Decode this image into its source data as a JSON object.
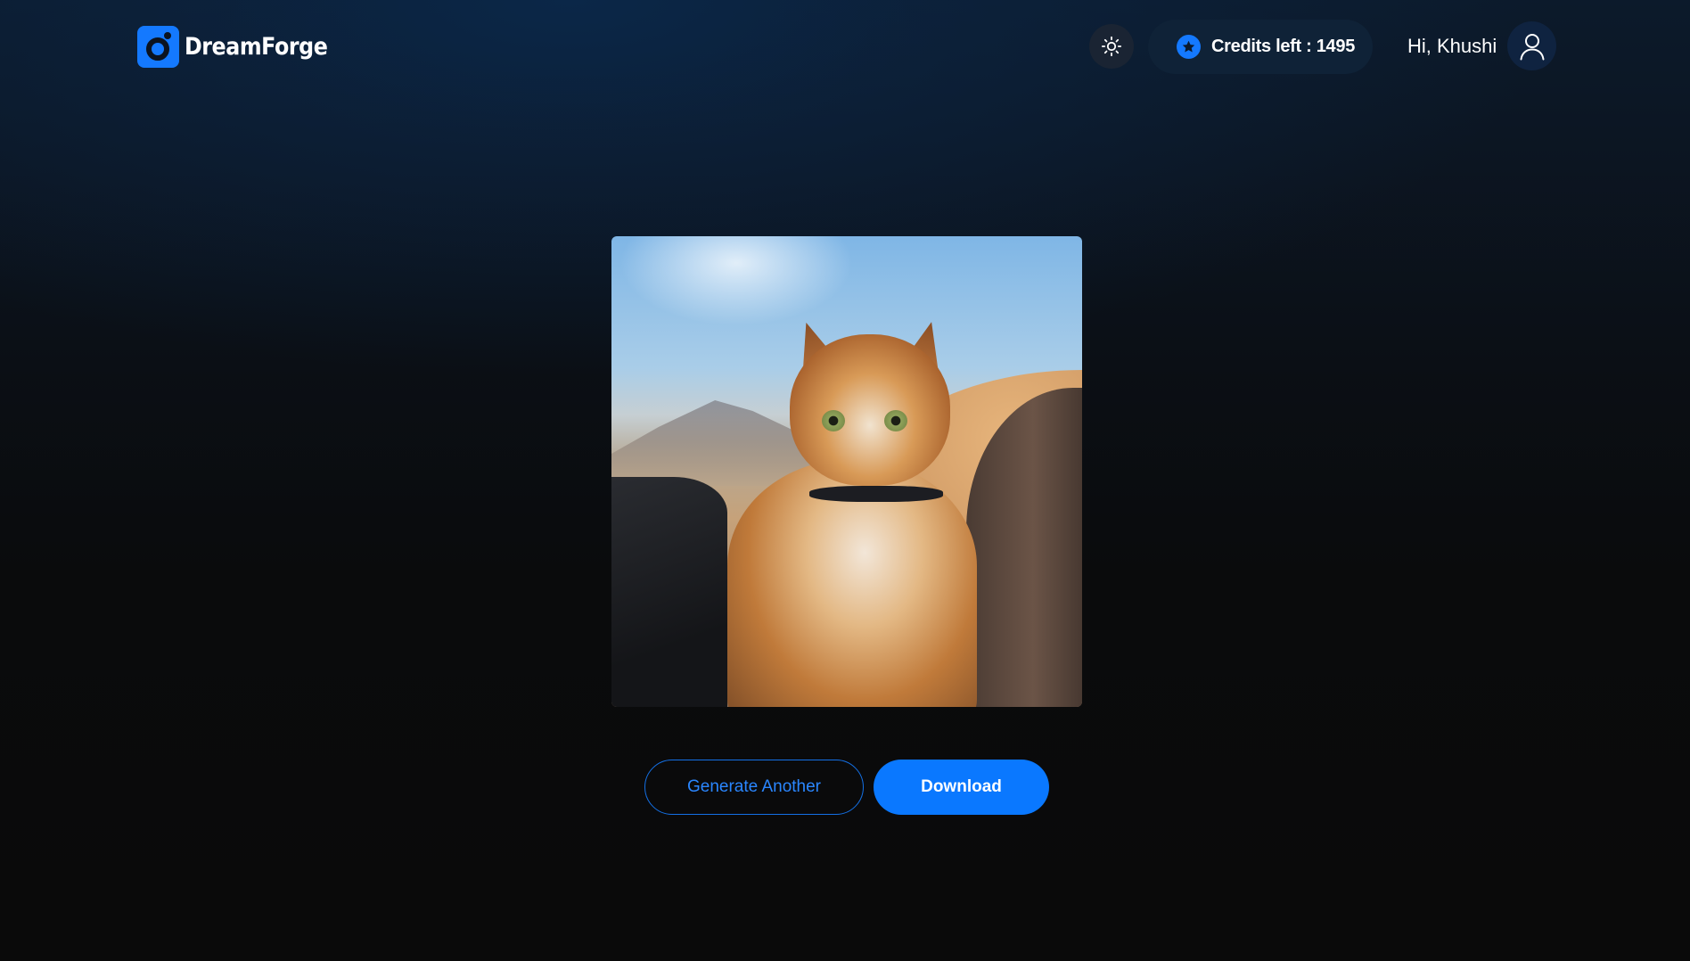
{
  "app": {
    "name": "DreamForge",
    "accent_color": "#1479ff"
  },
  "header": {
    "theme_icon": "sun-icon",
    "credits": {
      "label": "Credits left : 1495",
      "icon": "star-badge-icon"
    },
    "greeting": "Hi, Khushi",
    "avatar_icon": "user-icon"
  },
  "main": {
    "image": {
      "subject": "cat"
    },
    "actions": {
      "generate_another_label": "Generate Another",
      "download_label": "Download"
    }
  }
}
